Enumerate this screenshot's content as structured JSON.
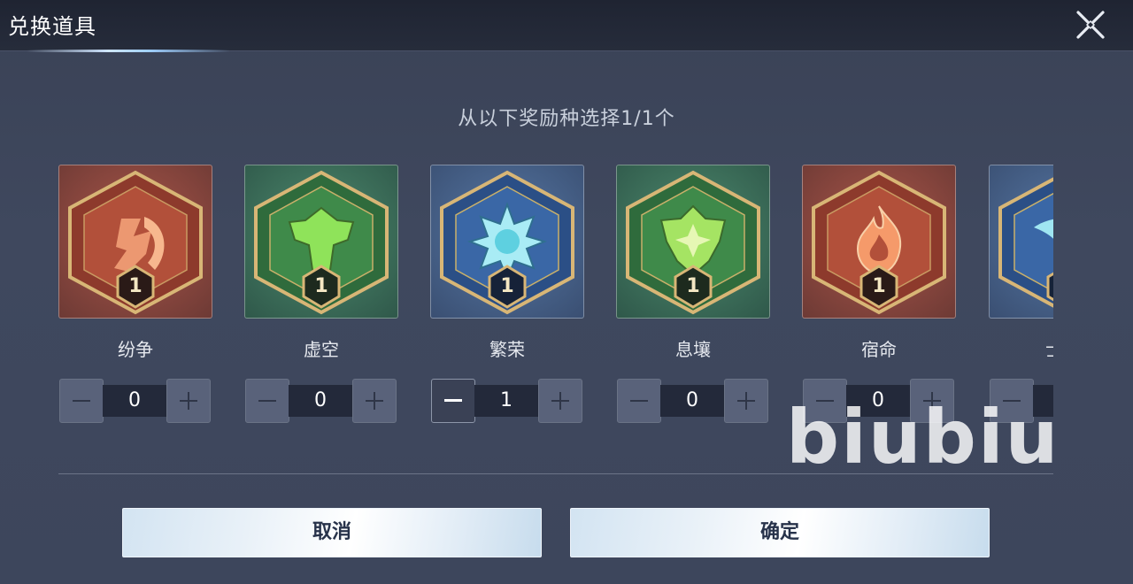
{
  "dialog": {
    "title": "兑换道具",
    "subtitle": "从以下奖励种选择1/1个",
    "close_icon": "close-x-icon"
  },
  "rewards": [
    {
      "name": "纷争",
      "quantity": "0",
      "badge": "1",
      "theme": "red",
      "icon": "axe-emblem-icon",
      "minus_enabled": false
    },
    {
      "name": "虚空",
      "quantity": "0",
      "badge": "1",
      "theme": "green",
      "icon": "void-crest-icon",
      "minus_enabled": false
    },
    {
      "name": "繁荣",
      "quantity": "1",
      "badge": "1",
      "theme": "blue",
      "icon": "star-crystal-icon",
      "minus_enabled": true
    },
    {
      "name": "息壤",
      "quantity": "0",
      "badge": "1",
      "theme": "green",
      "icon": "leaf-shield-icon",
      "minus_enabled": false
    },
    {
      "name": "宿命",
      "quantity": "0",
      "badge": "1",
      "theme": "red",
      "icon": "flame-emblem-icon",
      "minus_enabled": false
    },
    {
      "name": "",
      "quantity": "",
      "badge": "",
      "theme": "blue",
      "icon": "wave-emblem-icon",
      "minus_enabled": false
    }
  ],
  "buttons": {
    "cancel": "取消",
    "confirm": "确定"
  },
  "watermark": "biubiu",
  "colors": {
    "red_tile": "#86453d",
    "green_tile": "#3b6c58",
    "blue_tile": "#455f86",
    "badge_gold": "#d9b872",
    "button_text": "#27324a"
  }
}
